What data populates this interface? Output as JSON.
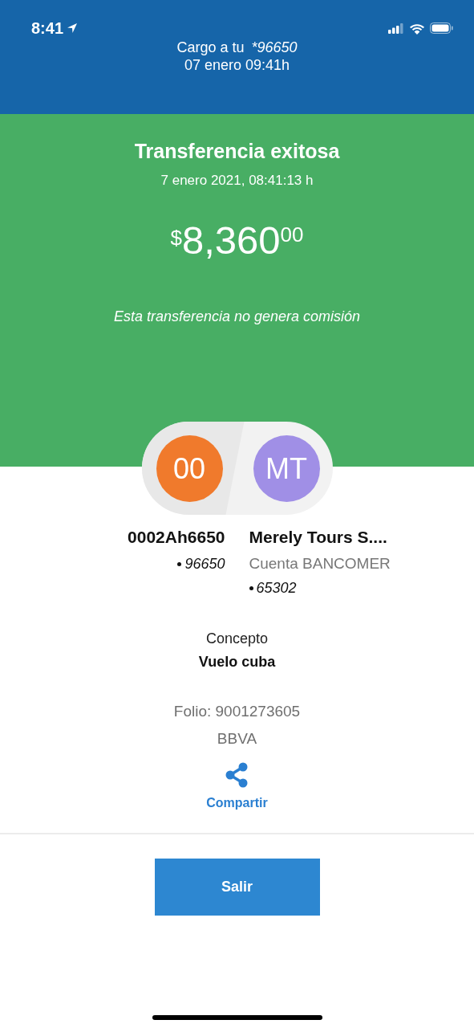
{
  "status_bar": {
    "time": "8:41"
  },
  "header": {
    "charge_label": "Cargo a tu",
    "account": "*96650",
    "date": "07 enero 09:41h"
  },
  "summary": {
    "title": "Transferencia exitosa",
    "datetime": "7 enero 2021, 08:41:13 h",
    "amount": {
      "currency": "$",
      "integer": "8,360",
      "cents": "00"
    },
    "note": "Esta transferencia no genera comisión"
  },
  "parties": [
    {
      "initials": "00",
      "color": "#f07a2c",
      "name": "0002Ah6650",
      "lines": [
        {
          "text": "96650",
          "bullet": true
        }
      ]
    },
    {
      "initials": "MT",
      "color": "#a08fe6",
      "name": "Merely Tours S....",
      "lines": [
        {
          "text": "Cuenta BANCOMER",
          "bullet": false
        },
        {
          "text": "65302",
          "bullet": true
        }
      ]
    }
  ],
  "concept": {
    "label": "Concepto",
    "value": "Vuelo cuba"
  },
  "folio": "Folio: 9001273605",
  "bank": "BBVA",
  "share": {
    "label": "Compartir"
  },
  "exit_button": "Salir"
}
